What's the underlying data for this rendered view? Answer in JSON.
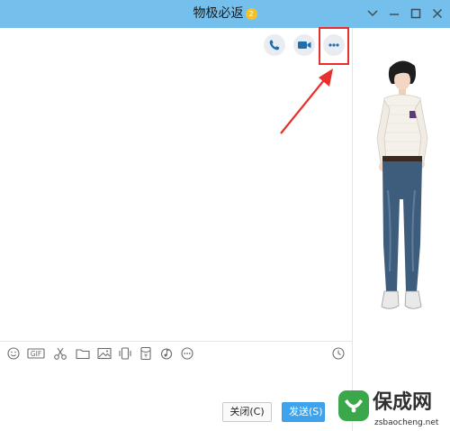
{
  "window": {
    "title": "物极必返",
    "vip_badge": "2",
    "controls": [
      "chevron-down-icon",
      "minimize-icon",
      "maximize-icon",
      "close-icon"
    ]
  },
  "header_actions": [
    {
      "name": "voice-call-button",
      "icon": "phone-icon"
    },
    {
      "name": "video-call-button",
      "icon": "video-camera-icon"
    },
    {
      "name": "more-options-button",
      "icon": "ellipsis-icon"
    }
  ],
  "annotation": {
    "highlight_color": "#e7302b"
  },
  "toolbar": {
    "icons": [
      "smiley-icon",
      "gif-icon",
      "scissors-icon",
      "folder-icon",
      "image-icon",
      "shake-icon",
      "red-packet-icon",
      "music-icon",
      "more-icon"
    ],
    "gif_label": "GIF",
    "red_packet_label": "¥",
    "history_icon": "clock-icon"
  },
  "buttons": {
    "close_label": "关闭(C)",
    "send_label": "发送(S)"
  },
  "watermark": {
    "name": "保成网",
    "url": "zsbaocheng.net"
  },
  "colors": {
    "titlebar": "#74bfeb",
    "send_button": "#3ea3ec",
    "watermark_green": "#3aa84a"
  }
}
